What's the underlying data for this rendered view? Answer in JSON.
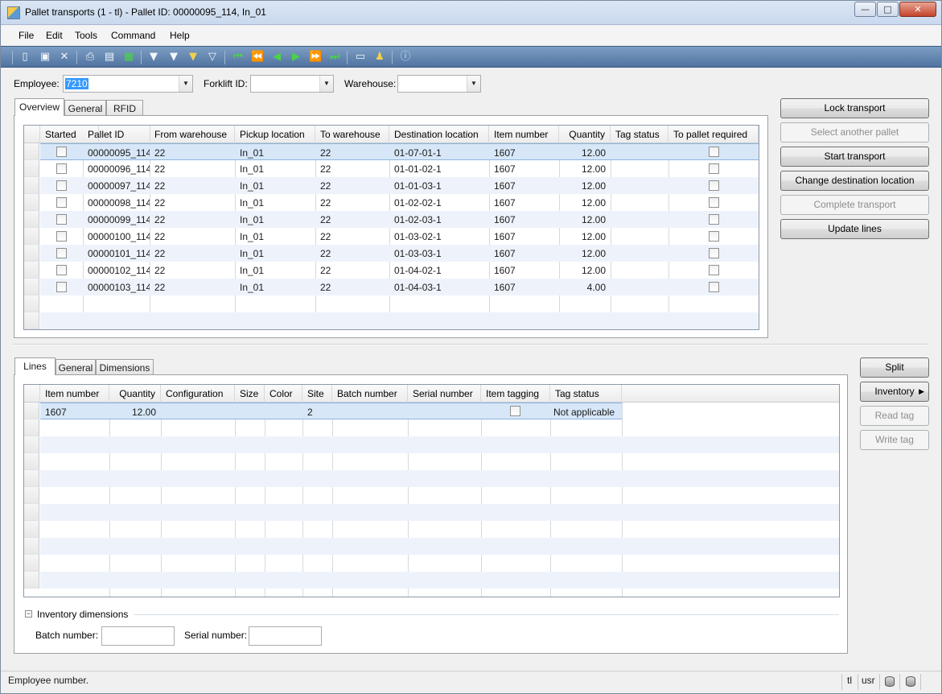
{
  "window": {
    "title": "Pallet transports (1 - tl) - Pallet ID: 00000095_114, In_01",
    "controls": {
      "minimize": "—",
      "maximize": "□",
      "close": "✕"
    }
  },
  "menu": [
    "File",
    "Edit",
    "Tools",
    "Command",
    "Help"
  ],
  "toolbar": {
    "icons": [
      "new-icon",
      "save-icon",
      "delete-icon",
      "print-icon",
      "print-preview-icon",
      "export-excel-icon",
      "filter-by-selection-icon",
      "filter-by-grid-icon",
      "advanced-filter-icon",
      "remove-filter-icon",
      "first-record-icon",
      "previous-page-icon",
      "previous-record-icon",
      "next-record-icon",
      "next-page-icon",
      "last-record-icon",
      "document-handling-icon",
      "alerts-icon",
      "help-icon"
    ]
  },
  "filters": {
    "employee_label": "Employee:",
    "employee_value": "7210",
    "forklift_label": "Forklift ID:",
    "forklift_value": "",
    "warehouse_label": "Warehouse:",
    "warehouse_value": ""
  },
  "top_tabs": [
    "Overview",
    "General",
    "RFID"
  ],
  "transports_grid": {
    "columns": [
      "Started",
      "Pallet ID",
      "From warehouse",
      "Pickup location",
      "To warehouse",
      "Destination location",
      "Item number",
      "Quantity",
      "Tag status",
      "To pallet required"
    ],
    "rows": [
      {
        "pallet": "00000095_114",
        "from": "22",
        "pickup": "In_01",
        "to": "22",
        "dest": "01-07-01-1",
        "item": "1607",
        "qty": "12.00",
        "tag": ""
      },
      {
        "pallet": "00000096_114",
        "from": "22",
        "pickup": "In_01",
        "to": "22",
        "dest": "01-01-02-1",
        "item": "1607",
        "qty": "12.00",
        "tag": ""
      },
      {
        "pallet": "00000097_114",
        "from": "22",
        "pickup": "In_01",
        "to": "22",
        "dest": "01-01-03-1",
        "item": "1607",
        "qty": "12.00",
        "tag": ""
      },
      {
        "pallet": "00000098_114",
        "from": "22",
        "pickup": "In_01",
        "to": "22",
        "dest": "01-02-02-1",
        "item": "1607",
        "qty": "12.00",
        "tag": ""
      },
      {
        "pallet": "00000099_114",
        "from": "22",
        "pickup": "In_01",
        "to": "22",
        "dest": "01-02-03-1",
        "item": "1607",
        "qty": "12.00",
        "tag": ""
      },
      {
        "pallet": "00000100_114",
        "from": "22",
        "pickup": "In_01",
        "to": "22",
        "dest": "01-03-02-1",
        "item": "1607",
        "qty": "12.00",
        "tag": ""
      },
      {
        "pallet": "00000101_114",
        "from": "22",
        "pickup": "In_01",
        "to": "22",
        "dest": "01-03-03-1",
        "item": "1607",
        "qty": "12.00",
        "tag": ""
      },
      {
        "pallet": "00000102_114",
        "from": "22",
        "pickup": "In_01",
        "to": "22",
        "dest": "01-04-02-1",
        "item": "1607",
        "qty": "12.00",
        "tag": ""
      },
      {
        "pallet": "00000103_114",
        "from": "22",
        "pickup": "In_01",
        "to": "22",
        "dest": "01-04-03-1",
        "item": "1607",
        "qty": "4.00",
        "tag": ""
      }
    ]
  },
  "transport_buttons": {
    "lock": "Lock transport",
    "select_other": "Select another pallet",
    "start": "Start transport",
    "change_dest": "Change destination location",
    "complete": "Complete transport",
    "update": "Update lines"
  },
  "bottom_tabs": [
    "Lines",
    "General",
    "Dimensions"
  ],
  "lines_grid": {
    "columns": [
      "Item number",
      "Quantity",
      "Configuration",
      "Size",
      "Color",
      "Site",
      "Batch number",
      "Serial number",
      "Item tagging",
      "Tag status"
    ],
    "rows": [
      {
        "item": "1607",
        "qty": "12.00",
        "config": "",
        "size": "",
        "color": "",
        "site": "2",
        "batch": "",
        "serial": "",
        "tag_status": "Not applicable"
      }
    ]
  },
  "line_buttons": {
    "split": "Split",
    "inventory": "Inventory",
    "inventory_arrow": "▶",
    "read_tag": "Read tag",
    "write_tag": "Write tag"
  },
  "inventory_dimensions": {
    "title": "Inventory dimensions",
    "collapse": "−",
    "batch_label": "Batch number:",
    "batch_value": "",
    "serial_label": "Serial number:",
    "serial_value": ""
  },
  "status": {
    "message": "Employee number.",
    "company": "tl",
    "layer": "usr"
  }
}
